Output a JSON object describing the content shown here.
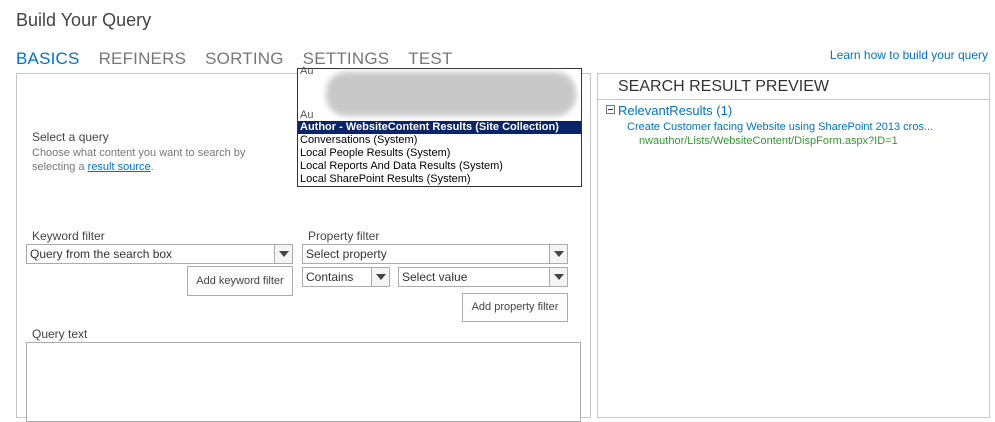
{
  "page": {
    "title": "Build Your Query"
  },
  "tabs": [
    {
      "label": "BASICS",
      "active": true
    },
    {
      "label": "REFINERS"
    },
    {
      "label": "SORTING"
    },
    {
      "label": "SETTINGS"
    },
    {
      "label": "TEST"
    }
  ],
  "learn_link": "Learn how to build your query",
  "select_query": {
    "label": "Select a query",
    "description": "Choose what content you want to search by selecting a",
    "link_text": "result source",
    "after_link": "."
  },
  "dropdown": {
    "partial_top": "Au",
    "partial_mid": "Au",
    "items": [
      {
        "label": "Author - WebsiteContent Results (Site Collection)",
        "selected": true
      },
      {
        "label": "Conversations (System)"
      },
      {
        "label": "Local People Results (System)"
      },
      {
        "label": "Local Reports And Data Results (System)"
      },
      {
        "label": "Local SharePoint Results (System)"
      }
    ]
  },
  "keyword_filter": {
    "label": "Keyword filter",
    "value": "Query from the search box",
    "add_button": "Add keyword filter"
  },
  "property_filter": {
    "label": "Property filter",
    "property_value": "Select property",
    "operator_value": "Contains",
    "value_value": "Select value",
    "add_button": "Add property filter"
  },
  "query_text": {
    "label": "Query text",
    "value": ""
  },
  "preview": {
    "header": "SEARCH RESULT PREVIEW",
    "group": "RelevantResults (1)",
    "result_title": "Create Customer facing Website using SharePoint 2013 cros...",
    "result_url": "nwauthor/Lists/WebsiteContent/DispForm.aspx?ID=1"
  },
  "colors": {
    "accent": "#0072c6",
    "url": "#339933",
    "selected": "#0a246a"
  }
}
